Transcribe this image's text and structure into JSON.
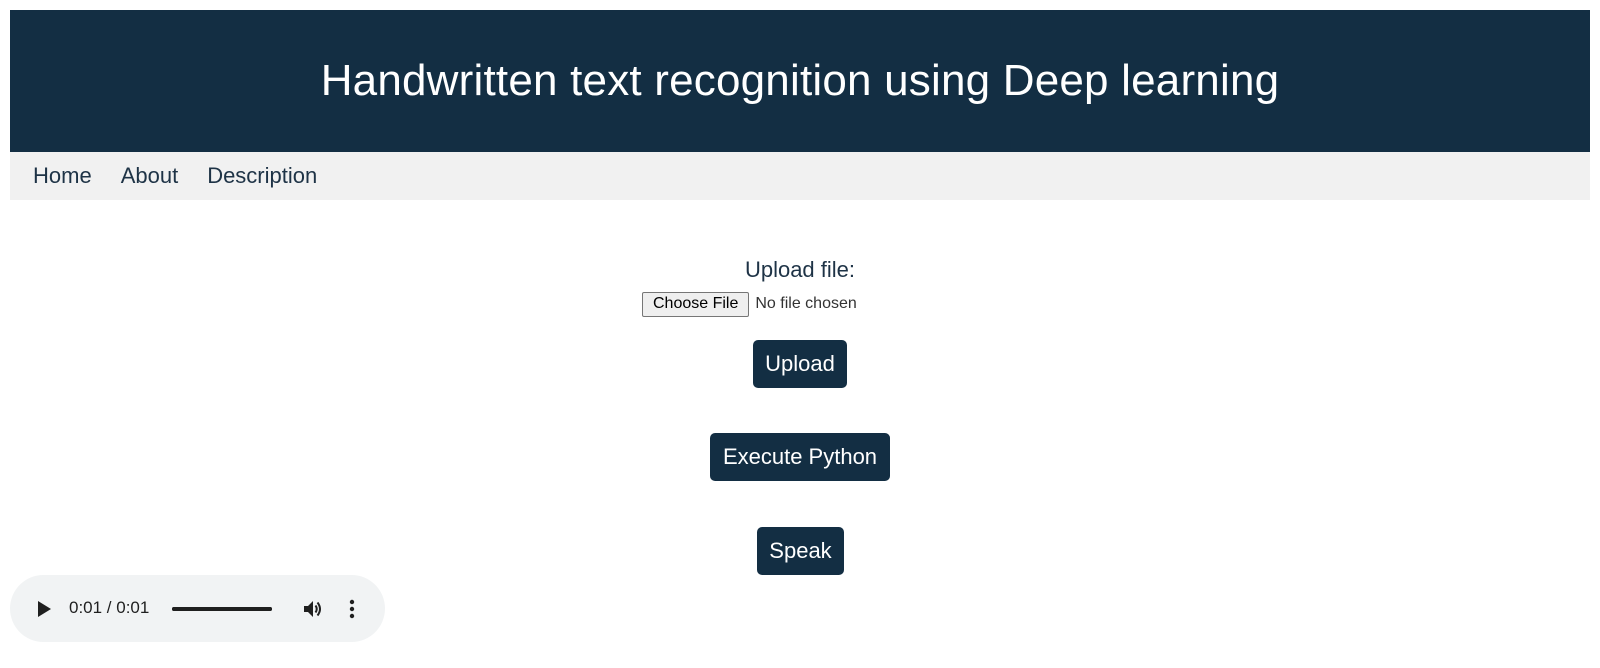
{
  "header": {
    "title": "Handwritten text recognition using Deep learning"
  },
  "nav": {
    "items": [
      {
        "label": "Home"
      },
      {
        "label": "About"
      },
      {
        "label": "Description"
      }
    ]
  },
  "upload": {
    "label": "Upload file:",
    "choose_button": "Choose File",
    "file_status": "No file chosen",
    "upload_button": "Upload"
  },
  "actions": {
    "execute_label": "Execute Python",
    "speak_label": "Speak"
  },
  "audio": {
    "time_display": "0:01 / 0:01",
    "progress_fraction": 1.0,
    "icons": [
      "play-icon",
      "volume-icon",
      "more-vert-icon"
    ]
  },
  "colors": {
    "primary": "#132e43",
    "nav_background": "#f1f1f1",
    "player_background": "#f1f3f4"
  }
}
